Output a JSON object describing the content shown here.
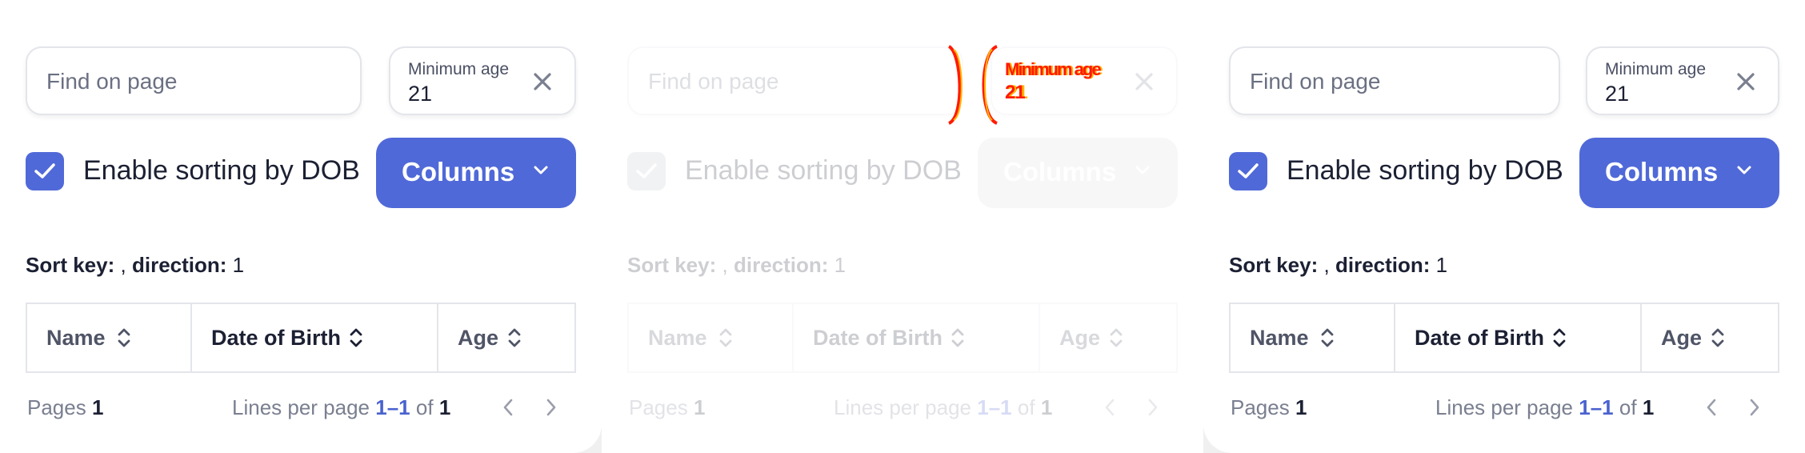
{
  "search": {
    "placeholder": "Find on page"
  },
  "min_age": {
    "label": "Minimum age",
    "value": "21"
  },
  "sorting": {
    "label": "Enable sorting by DOB",
    "checked": true
  },
  "columns_button": {
    "label": "Columns"
  },
  "sort_info": {
    "key_label": "Sort key:",
    "key_value": ",",
    "direction_label": "direction:",
    "direction_value": "1"
  },
  "table": {
    "headers": [
      "Name",
      "Date of Birth",
      "Age"
    ]
  },
  "footer": {
    "pages_label": "Pages",
    "pages_value": "1",
    "lines_label": "Lines per page",
    "range": "1–1",
    "of_label": "of",
    "total": "1"
  },
  "ghost_overlay": {
    "label": "Minimum age",
    "value": "21"
  },
  "colors": {
    "accent": "#5069d8",
    "text": "#1c2033",
    "muted": "#7a7f90",
    "border": "#e3e5ea",
    "ghost": "#ff1a00"
  }
}
